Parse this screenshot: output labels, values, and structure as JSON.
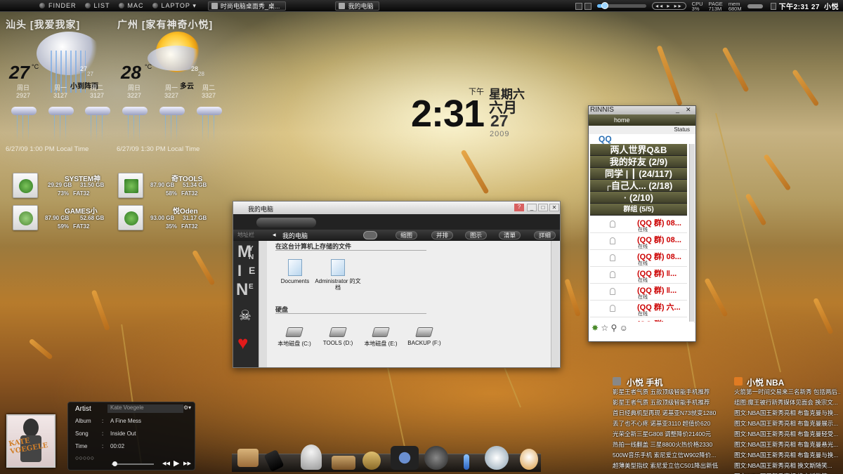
{
  "topbar": {
    "menu": [
      "Finder",
      "List",
      "Mac",
      "Laptop"
    ],
    "laptop_arrow": "▾",
    "tasks": [
      "时尚电脑桌面秀_桌...",
      "我的电脑"
    ],
    "media_controls": "◂◂ ▸ ▸▸",
    "cpu_label": "CPU",
    "cpu_value": "3%",
    "page_label": "PAGE",
    "page_value": "713M",
    "mem_label": "mem",
    "mem_value": "680M",
    "clock": "下午2:31 27",
    "user": "小悦",
    "volume_percent": 15
  },
  "weather": {
    "city1": "汕头 [我爱我家]",
    "city2": "广州 [家有神奇小悦]",
    "temp1": "27",
    "temp2": "28",
    "degree": "°C",
    "hi1": "27",
    "lo1": "27",
    "hi2": "28",
    "lo2": "28",
    "desc1": "小到阵雨",
    "desc2": "多云",
    "forecast1": [
      {
        "day": "周日",
        "hi": "29",
        "lo": "27"
      },
      {
        "day": "周一",
        "hi": "31",
        "lo": "27"
      },
      {
        "day": "周二",
        "hi": "31",
        "lo": "27"
      }
    ],
    "forecast2": [
      {
        "day": "周日",
        "hi": "32",
        "lo": "27"
      },
      {
        "day": "周一",
        "hi": "32",
        "lo": "27"
      },
      {
        "day": "周二",
        "hi": "33",
        "lo": "27"
      }
    ],
    "time1": "6/27/09 1:00 PM Local Time",
    "time2": "6/27/09 1:30 PM Local Time"
  },
  "drives": [
    {
      "name": "SYSTEM神",
      "used": "29.29 GB",
      "total": "31.50 GB",
      "pct": "73%",
      "fs": "FAT32"
    },
    {
      "name": "奇TOOLS",
      "used": "87.90 GB",
      "total": "51.34 GB",
      "pct": "58%",
      "fs": "FAT32"
    },
    {
      "name": "GAMES小",
      "used": "87.90 GB",
      "total": "52.68 GB",
      "pct": "59%",
      "fs": "FAT32"
    },
    {
      "name": "悦Oden",
      "used": "93.00 GB",
      "total": "31.17 GB",
      "pct": "35%",
      "fs": "FAT32"
    }
  ],
  "clock": {
    "time": "2:31",
    "ampm": "下午",
    "weekday": "星期六",
    "month": "六月",
    "day": "27",
    "year": "2009"
  },
  "explorer": {
    "title": "我的电脑",
    "address": "我的电脑",
    "back": "◂",
    "nav_label": "地址栏",
    "views": [
      "缩图",
      "并排",
      "图示",
      "清單",
      "詳細"
    ],
    "section1": "在这台计算机上存储的文件",
    "section2": "硬盘",
    "folders": [
      "Documents",
      "Administrator 的文档"
    ],
    "drives": [
      "本地磁盘 (C:)",
      "TOOLS (D:)",
      "本地磁盘 (E:)",
      "BACKUP (F:)"
    ],
    "side_letters": [
      "M",
      "I",
      "N",
      "E"
    ],
    "side_small": [
      "Y",
      "N",
      "E"
    ]
  },
  "qq": {
    "title": "RINNIS",
    "home": "home",
    "status": "Status",
    "logo": "QQ",
    "groups": [
      "两人世界Q&B",
      "我的好友  (2/9)",
      "同学 | ┃  (24/117)",
      "┌自己人...  (2/18)",
      "·  (2/10)"
    ],
    "qun": "群组  (5/5)",
    "members": [
      "(QQ 群) 08...",
      "(QQ 群) 08...",
      "(QQ 群) 08...",
      "(QQ 群) ‖...",
      "(QQ 群) ‖...",
      "(QQ 群) 六...",
      "(QQ 群)"
    ],
    "online": "在线",
    "min_btn": "_",
    "close_btn": "✕"
  },
  "feeds": {
    "left_title": "小悦  手机",
    "left_items": [
      "影星王者气质 五款顶级智能手机推荐",
      "影星王者气质 五款顶级智能手机推荐",
      "首日经典机型再现 诺基亚N73就变1280",
      "丢了也不心疼 诺基亚3110 超值价620",
      "光荣全新三星G808 调整降价21400元",
      "热拍一线翻盖 三星8800火热价格2330",
      "500W音乐手机 索尼爱立信W902降价...",
      "超薄美型指纹 索尼爱立信C501降出新低"
    ],
    "right_title": "小悦  NBA",
    "right_items": [
      "火箭第一时间交易来三名新秀 包括两后...",
      "组图:魔王被行新秀媒体见面会 换宗文...",
      "图文:NBA国王新秀亮相 布鲁克曼与换...",
      "图文:NBA国王新秀亮相 布鲁克曼展示...",
      "图文:NBA国王新秀亮相 布鲁克曼轻受...",
      "图文:NBA国王新秀亮相 布鲁克曼悬光...",
      "图文:NBA国王新秀亮相 布鲁克曼与换...",
      "图文:NBA国王新秀亮相 换文斯随笑...",
      "图文:NBA国王新秀亮相 换文斯微笑"
    ]
  },
  "player": {
    "artist_label": "Artist",
    "artist": "Kate Voegele",
    "album_label": "Album",
    "album": "A Fine Mess",
    "song_label": "Song",
    "song": "Inside Out",
    "time_label": "Time",
    "time": "00:02",
    "sep": ":",
    "art_text": "KATE VOEGELE",
    "progress": 0.02
  },
  "colors": {
    "accent": "#6bbcff",
    "qq_group_bg": "#4f4f33",
    "qq_member_red": "#cc0000"
  }
}
